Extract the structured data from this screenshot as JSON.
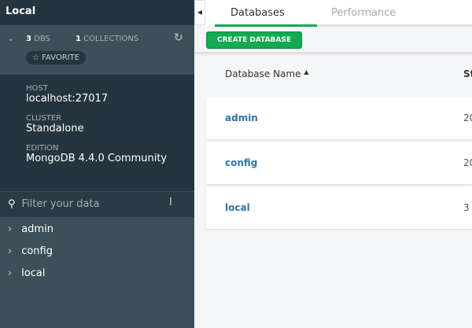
{
  "sidebar": {
    "title": "Local",
    "dbs_count": "3",
    "dbs_label": "DBS",
    "collections_count": "1",
    "collections_label": "COLLECTIONS",
    "favorite": "FAVORITE",
    "host_label": "HOST",
    "host": "localhost:27017",
    "cluster_label": "CLUSTER",
    "cluster": "Standalone",
    "edition_label": "EDITION",
    "edition": "MongoDB 4.4.0 Community",
    "filter_placeholder": "Filter your data",
    "databases": [
      {
        "name": "admin"
      },
      {
        "name": "config"
      },
      {
        "name": "local"
      }
    ]
  },
  "main": {
    "tabs": [
      {
        "label": "Databases",
        "active": true
      },
      {
        "label": "Performance"
      }
    ],
    "create_button": "CREATE DATABASE",
    "columns": [
      "Database Name",
      "St"
    ],
    "sort_indicator": "▲",
    "rows": [
      {
        "name": "admin",
        "storage": "20"
      },
      {
        "name": "config",
        "storage": "20"
      },
      {
        "name": "local",
        "storage": "3"
      }
    ]
  },
  "colors": {
    "accent": "#13aa52",
    "sidebar": "#3d4f58",
    "link": "#2f73a8"
  }
}
